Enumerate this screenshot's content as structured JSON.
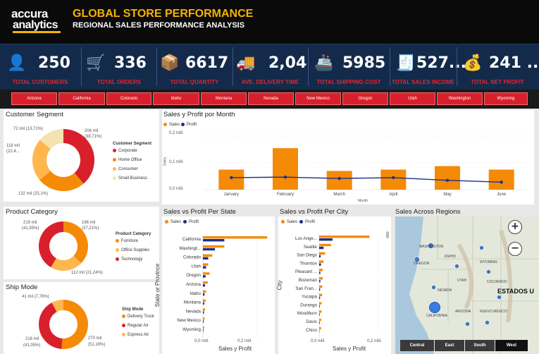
{
  "header": {
    "logo_top": "accura",
    "logo_bottom": "analytics",
    "title": "GLOBAL STORE PERFORMANCE",
    "subtitle": "REGIONAL SALES PERFORMANCE ANALYSIS"
  },
  "kpis": [
    {
      "icon": "user-icon",
      "glyph": "👤",
      "value": "250",
      "label": "TOTAL CUSTOMERS"
    },
    {
      "icon": "cart-icon",
      "glyph": "🛒",
      "value": "336",
      "label": "TOTAL ORDERS"
    },
    {
      "icon": "box-icon",
      "glyph": "📦",
      "value": "6617",
      "label": "TOTAL QUANTITY"
    },
    {
      "icon": "truck-icon",
      "glyph": "🚚",
      "value": "2,04",
      "label": "AVE. DELIVERY TIME"
    },
    {
      "icon": "ship-icon",
      "glyph": "🚢",
      "value": "5985",
      "label": "TOTAL SHIPPING COST"
    },
    {
      "icon": "invoice-icon",
      "glyph": "🧾",
      "value": "527...",
      "label": "TOTAL SALES INCOME"
    },
    {
      "icon": "coins-icon",
      "glyph": "💰",
      "value": "241 ...",
      "label": "TOTAL NET PROFIT"
    }
  ],
  "states": [
    "Arizona",
    "California",
    "Colorado",
    "Idaho",
    "Montana",
    "Nevada",
    "New Mexico",
    "Oregon",
    "Utah",
    "Washington",
    "Wyoming"
  ],
  "customer_segment": {
    "title": "Customer Segment",
    "legend_title": "Customer Segment",
    "labels": [
      "204 mil",
      "(38,71%)",
      "132 mil (25,1%)",
      "118 mil",
      "(22,4...",
      "72 mil (13,71%)"
    ],
    "legend": [
      "Corporate",
      "Home Office",
      "Consumer",
      "Small Business"
    ]
  },
  "product_category": {
    "title": "Product Category",
    "legend_title": "Product Category",
    "labels": [
      "196 mil",
      "(37,21%)",
      "112 mil (21,24%)",
      "219 mil",
      "(41,55%)"
    ],
    "legend": [
      "Furniture",
      "Office Supplies",
      "Technology"
    ]
  },
  "ship_mode": {
    "title": "Ship Mode",
    "legend_title": "Ship Mode",
    "labels": [
      "41 mil (7,76%)",
      "270 mil",
      "(51,18%)",
      "216 mil",
      "(41,05%)"
    ],
    "legend": [
      "Delivery Truck",
      "Regular Air",
      "Express Air"
    ]
  },
  "monthly": {
    "title": "Sales y Profit por Month",
    "legend": [
      "Sales",
      "Profit"
    ],
    "y_title": "Sales",
    "x_title": "Month",
    "ticks": [
      "0,2 mill.",
      "0,1 mill.",
      "0,0 mill."
    ]
  },
  "by_state": {
    "title": "Sales vs Profit Per State",
    "legend": [
      "Sales",
      "Profit"
    ],
    "y_title": "State or Province",
    "x_title": "Sales y Profit",
    "ticks": [
      "0,0 mill.",
      "0,2 mill."
    ]
  },
  "by_city": {
    "title": "Sales vs Profit Per City",
    "legend": [
      "Sales",
      "Profit"
    ],
    "y_title": "City",
    "x_title": "Sales y Profit",
    "ticks": [
      "0,0 mill.",
      "0,2 mill."
    ]
  },
  "regions": {
    "title": "Sales Across Regions",
    "country_label": "ESTADOS U",
    "buttons": [
      "Central",
      "East",
      "South",
      "West"
    ],
    "zoom_in": "+",
    "zoom_out": "−",
    "place_labels": [
      "WASHINGTON",
      "OREGON",
      "IDAHO",
      "NEVADA",
      "UTAH",
      "CALIFORNIA",
      "ARIZONA",
      "WYOMING",
      "COLORADO",
      "NUEVO MÉXICO"
    ]
  },
  "colors": {
    "sales": "#f58a07",
    "profit": "#1c2f8a",
    "red": "#d8202c",
    "orange": "#f58a07",
    "amber": "#ffb74d",
    "cream": "#f2e3b0",
    "navy": "#142a4a"
  },
  "chart_data": [
    {
      "type": "pie",
      "categories": [
        "Corporate",
        "Home Office",
        "Consumer",
        "Small Business"
      ],
      "values": [
        38.71,
        25.1,
        22.4,
        13.71
      ],
      "title": "Customer Segment"
    },
    {
      "type": "pie",
      "categories": [
        "Furniture",
        "Office Supplies",
        "Technology"
      ],
      "values": [
        37.21,
        21.24,
        41.55
      ],
      "title": "Product Category"
    },
    {
      "type": "pie",
      "categories": [
        "Delivery Truck",
        "Regular Air",
        "Express Air"
      ],
      "values": [
        51.18,
        41.05,
        7.76
      ],
      "title": "Ship Mode"
    },
    {
      "type": "bar",
      "title": "Sales y Profit por Month",
      "categories": [
        "January",
        "February",
        "March",
        "April",
        "May",
        "June"
      ],
      "series": [
        {
          "name": "Sales",
          "values": [
            0.075,
            0.155,
            0.07,
            0.075,
            0.088,
            0.075
          ]
        },
        {
          "name": "Profit",
          "values": [
            0.045,
            0.047,
            0.042,
            0.045,
            0.035,
            0.028
          ]
        }
      ],
      "ylim": [
        0,
        0.2
      ]
    },
    {
      "type": "bar",
      "title": "Sales vs Profit Per State",
      "categories": [
        "California",
        "Washingt...",
        "Colorado",
        "Utah",
        "Oregon",
        "Arizona",
        "Idaho",
        "Montana",
        "Nevada",
        "New Mexico",
        "Wyoming"
      ],
      "series": [
        {
          "name": "Sales",
          "values": [
            0.24,
            0.08,
            0.035,
            0.02,
            0.025,
            0.018,
            0.012,
            0.01,
            0.008,
            0.006,
            0.005
          ]
        },
        {
          "name": "Profit",
          "values": [
            0.08,
            0.045,
            0.02,
            0.012,
            0.01,
            0.008,
            0.006,
            0.005,
            0.004,
            0.003,
            0.002
          ]
        }
      ],
      "xlim": [
        0,
        0.25
      ]
    },
    {
      "type": "bar",
      "title": "Sales vs Profit Per City",
      "categories": [
        "Los Ange...",
        "Seattle",
        "San Diego",
        "Thornton",
        "Pleasant ...",
        "Bozeman",
        "San Fran...",
        "Yucaipa",
        "Durango",
        "Woodburn",
        "Davis",
        "Chico"
      ],
      "series": [
        {
          "name": "Sales",
          "values": [
            0.17,
            0.04,
            0.02,
            0.015,
            0.012,
            0.012,
            0.01,
            0.01,
            0.008,
            0.008,
            0.007,
            0.006
          ]
        },
        {
          "name": "Profit",
          "values": [
            0.045,
            0.015,
            0.005,
            0.006,
            0.004,
            0.004,
            0.003,
            0.003,
            0.002,
            0.002,
            0.002,
            0.001
          ]
        }
      ],
      "xlim": [
        0,
        0.25
      ]
    }
  ]
}
